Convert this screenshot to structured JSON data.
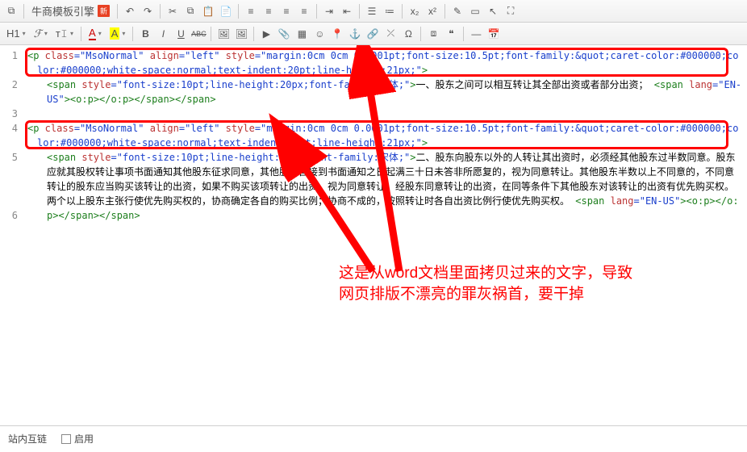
{
  "toolbar1": {
    "template_btn": "牛商模板引擎",
    "new_badge": "新"
  },
  "toolbar2": {
    "h1": "H1",
    "font_family": "ℱ",
    "font_size": "т𝙸",
    "font_color": "A",
    "bg_color": "A",
    "bold": "B",
    "italic": "I",
    "underline": "U",
    "strike": "ABC"
  },
  "code": {
    "l1": {
      "open": "<p",
      "a1n": " class",
      "a1v": "=\"MsoNormal\"",
      "a2n": " align",
      "a2v": "=\"left\"",
      "a3n": " style",
      "a3v": "=\"margin:0cm 0cm 0.0001pt;font-size:10.5pt;font-family:&quot;caret-color:#000000;color:#000000;white-space:normal;text-indent:20pt;line-height:21px;\"",
      "close": ">"
    },
    "l2": {
      "open": "<span",
      "a1n": " style",
      "a1v": "=\"font-size:10pt;line-height:20px;font-family:宋体;\"",
      "close": ">",
      "text1": "一、股东之间可以相互转让其全部出资或者部分出资；",
      "span2o": "<span",
      "span2a": " lang",
      "span2v": "=\"EN-US\"",
      "span2c": ">",
      "op": "<o:p></o:p>",
      "end": "</span></span>"
    },
    "l3": {
      "text": ""
    },
    "l4": {
      "open": "<p",
      "a1n": " class",
      "a1v": "=\"MsoNormal\"",
      "a2n": " align",
      "a2v": "=\"left\"",
      "a3n": " style",
      "a3v": "=\"margin:0cm 0cm 0.0001pt;font-size:10.5pt;font-family:&quot;caret-color:#000000;color:#000000;white-space:normal;text-indent:20pt;line-height:21px;\"",
      "close": ">"
    },
    "l5": {
      "open": "<span",
      "a1n": " style",
      "a1v": "=\"font-size:10pt;line-height:20px;font-family:宋体;\"",
      "close": ">",
      "text1": "二、股东向股东以外的人转让其出资时，必须经其他股东过半数同意。股东应就其股权转让事项书面通知其他股东征求同意，其他股东自接到书面通知之日起满三十日未答非所愿复的，视为同意转让。其他股东半数以上不同意的，不同意转让的股东应当购买该转让的出资，如果不购买该项转让的出资，视为同意转让。经股东同意转让的出资，在同等条件下其他股东对该转让的出资有优先购买权。两个以上股东主张行使优先购买权的，协商确定各自的购买比例；协商不成的，按照转让时各自出资比例行使优先购买权。",
      "span2o": "<span",
      "span2a": " lang",
      "span2v": "=\"EN-US\"",
      "span2c": ">",
      "op": "<o:p></o:p>",
      "end": "</span></span>"
    },
    "l6": {
      "text": ""
    }
  },
  "annotation": {
    "line1": "这是从word文档里面拷贝过来的文字，导致",
    "line2": "网页排版不漂亮的罪灰祸首，要干掉"
  },
  "footer": {
    "link_label": "站内互链",
    "enable_label": "启用"
  }
}
